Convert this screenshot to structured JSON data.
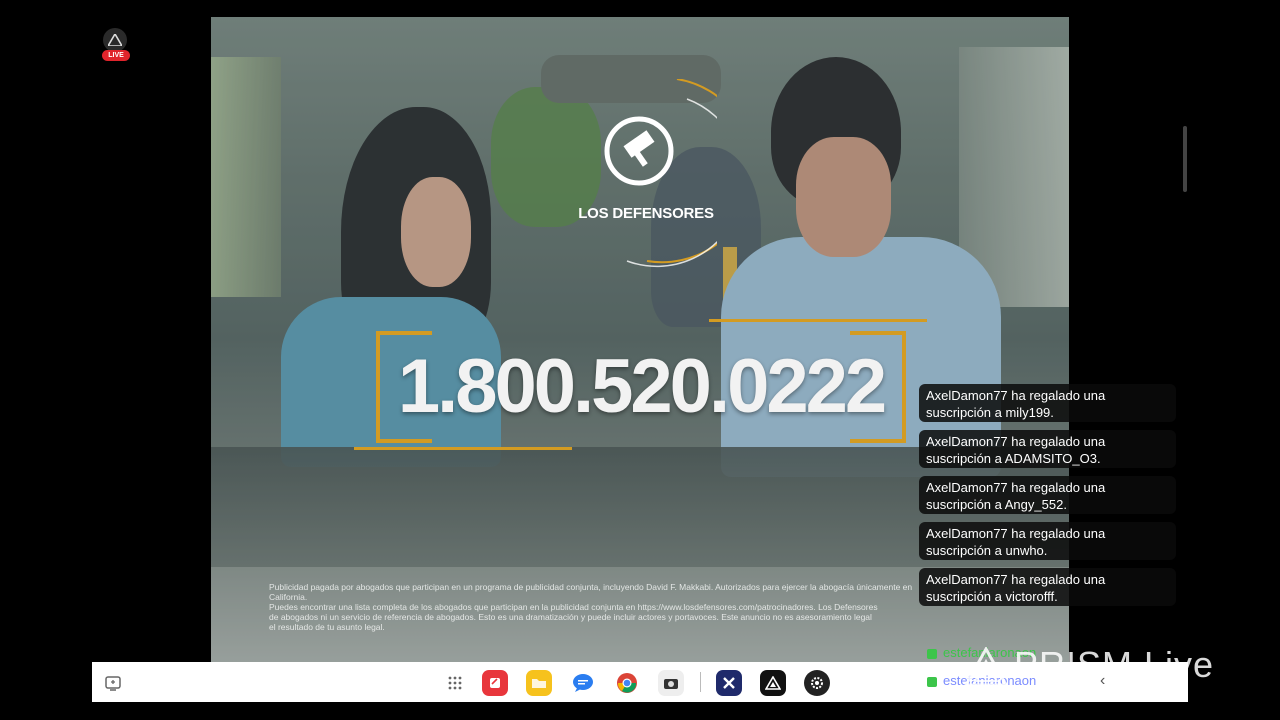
{
  "live_indicator": {
    "label": "LIVE"
  },
  "video": {
    "brand": "LOS DEFENSORES",
    "phone": "1.800.520.0222",
    "disclaimer": [
      "Publicidad pagada por abogados que participan en un programa de publicidad conjunta, incluyendo David F. Makkabi. Autorizados para ejercer la abogacía únicamente en California.",
      "Puedes encontrar una lista completa de los abogados que participan en la publicidad conjunta en https://www.losdefensores.com/patrocinadores. Los Defensores",
      "de abogados ni un servicio de referencia de abogados. Esto es una dramatización y puede incluir actores y portavoces. Este anuncio no es asesoramiento legal",
      "el resultado de tu asunto legal."
    ]
  },
  "chat": {
    "messages": [
      {
        "line1": "AxelDamon77 ha regalado una",
        "line2": "suscripción a mily199."
      },
      {
        "line1": "AxelDamon77 ha regalado una",
        "line2": "suscripción a ADAMSITO_O3."
      },
      {
        "line1": "AxelDamon77 ha regalado una",
        "line2": "suscripción a Angy_552."
      },
      {
        "line1": "AxelDamon77 ha regalado una",
        "line2": "suscripción a unwho."
      },
      {
        "line1": "AxelDamon77 ha regalado una",
        "line2": "suscripción a victorofff."
      }
    ],
    "user1": "estefaniaronaon",
    "user2": "estefaniaronaon"
  },
  "watermark": {
    "text": "PRISM Live"
  },
  "taskbar": {
    "apps": [
      "recent-apps-icon",
      "app-drawer-icon",
      "notes-app-icon",
      "files-app-icon",
      "messages-app-icon",
      "chrome-app-icon",
      "camera-app-icon",
      "xlink-app-icon",
      "prism-app-icon",
      "settings-app-icon"
    ]
  },
  "colors": {
    "accent": "#d39b22",
    "live_red": "#e0242c",
    "chat_green": "#3cc54a"
  }
}
